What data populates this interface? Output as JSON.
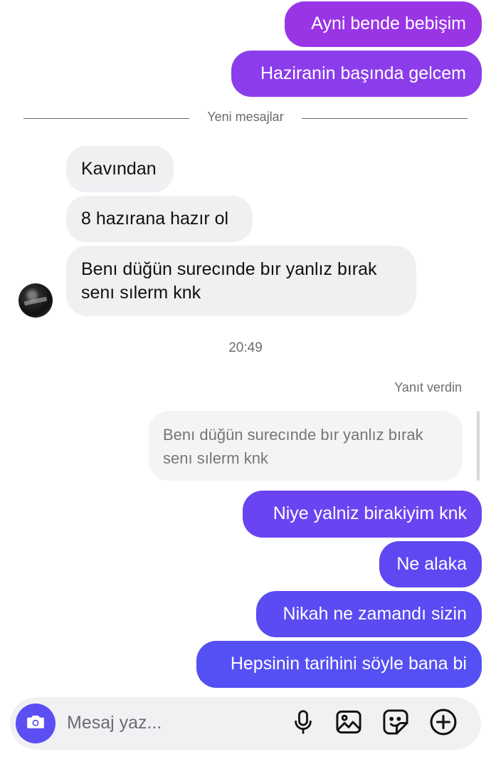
{
  "colors": {
    "outgoing_purple": "#8a3ee8",
    "outgoing_indigo": "#5b4ff3",
    "incoming_bg": "#f0f0f3"
  },
  "messages_top": [
    {
      "text": "Ayni bende bebişim"
    },
    {
      "text": "Haziranin başında gelcem"
    }
  ],
  "divider_label": "Yeni mesajlar",
  "incoming": [
    {
      "text": "Kavından"
    },
    {
      "text": "8 hazırana hazır ol"
    },
    {
      "line1": "Benı düğün surecınde bır yanlız bırak",
      "line2": "senı sılerm knk"
    }
  ],
  "timestamp": "20:49",
  "reply_label": "Yanıt verdin",
  "quoted": {
    "line1": "Benı düğün surecınde bır yanlız bırak",
    "line2": "senı sılerm knk"
  },
  "messages_bottom": [
    {
      "text": "Niye yalniz birakiyim knk"
    },
    {
      "text": "Ne alaka"
    },
    {
      "text": "Nikah ne zamandı sizin"
    },
    {
      "text": "Hepsinin tarihini söyle bana bi"
    }
  ],
  "composer": {
    "placeholder": "Mesaj yaz...",
    "icons": [
      "camera-icon",
      "microphone-icon",
      "image-icon",
      "sticker-icon",
      "add-icon"
    ]
  }
}
